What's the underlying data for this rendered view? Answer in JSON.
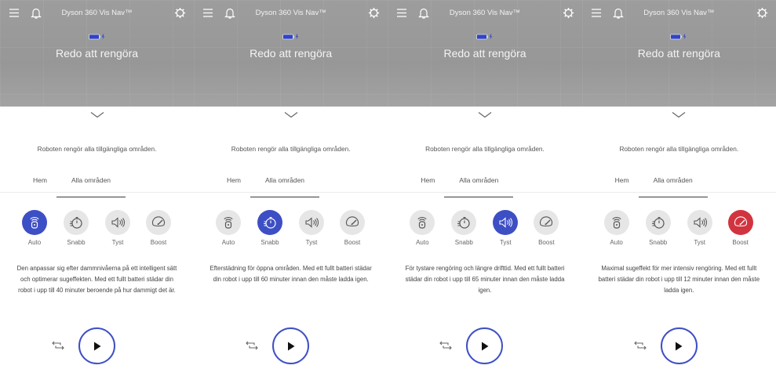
{
  "panels": [
    {
      "device_name": "Dyson 360 Vis Nav™",
      "status": "Redo att rengöra",
      "area_description": "Roboten rengör alla tillgängliga områden.",
      "tabs": [
        "Hem",
        "Alla områden"
      ],
      "modes": [
        "Auto",
        "Snabb",
        "Tyst",
        "Boost"
      ],
      "selected_mode": "Auto",
      "mode_description": "Den anpassar sig efter dammnivåerna på ett intelligent sätt och optimerar sugeffekten. Med ett fullt batteri städar din robot i upp till 40 minuter beroende på hur dammigt det är."
    },
    {
      "device_name": "Dyson 360 Vis Nav™",
      "status": "Redo att rengöra",
      "area_description": "Roboten rengör alla tillgängliga områden.",
      "tabs": [
        "Hem",
        "Alla områden"
      ],
      "modes": [
        "Auto",
        "Snabb",
        "Tyst",
        "Boost"
      ],
      "selected_mode": "Snabb",
      "mode_description": "Efterstädning för öppna områden. Med ett fullt batteri städar din robot i upp till 60 minuter innan den måste ladda igen."
    },
    {
      "device_name": "Dyson 360 Vis Nav™",
      "status": "Redo att rengöra",
      "area_description": "Roboten rengör alla tillgängliga områden.",
      "tabs": [
        "Hem",
        "Alla områden"
      ],
      "modes": [
        "Auto",
        "Snabb",
        "Tyst",
        "Boost"
      ],
      "selected_mode": "Tyst",
      "mode_description": "För tystare rengöring och längre drifttid. Med ett fullt batteri städar din robot i upp till 65 minuter innan den måste ladda igen."
    },
    {
      "device_name": "Dyson 360 Vis Nav™",
      "status": "Redo att rengöra",
      "area_description": "Roboten rengör alla tillgängliga områden.",
      "tabs": [
        "Hem",
        "Alla områden"
      ],
      "modes": [
        "Auto",
        "Snabb",
        "Tyst",
        "Boost"
      ],
      "selected_mode": "Boost",
      "mode_description": "Maximal sugeffekt för mer intensiv rengöring. Med ett fullt batteri städar din robot i upp till 12 minuter innan den måste ladda igen."
    }
  ],
  "icons": {
    "menu": "menu-icon",
    "notifications": "bell-icon",
    "settings": "gear-icon",
    "battery": "battery-icon",
    "expand": "chevron-down-icon",
    "schedule": "schedule-icon",
    "play": "play-icon",
    "auto": "auto-mode-icon",
    "snabb": "timer-icon",
    "tyst": "speaker-icon",
    "boost": "gauge-icon"
  },
  "colors": {
    "accent": "#3d4fc4",
    "boost_selected": "#d2343f",
    "header_bg": "#9a9a9a",
    "mode_bg": "#e6e6e6"
  }
}
